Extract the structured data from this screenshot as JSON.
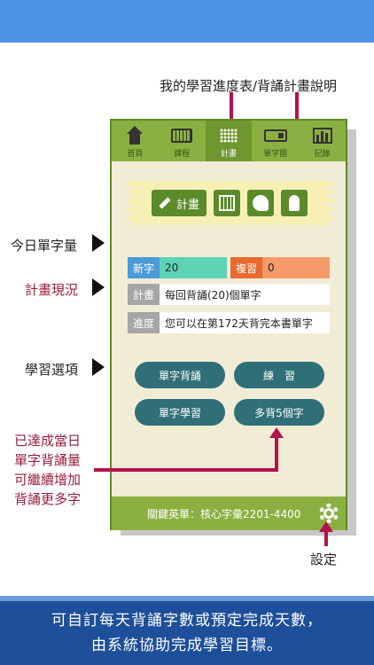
{
  "tabs": [
    {
      "label": "首頁",
      "icon": "home-icon"
    },
    {
      "label": "課程",
      "icon": "course-icon"
    },
    {
      "label": "計畫",
      "icon": "plan-dots-icon"
    },
    {
      "label": "單字團",
      "icon": "vocab-card-icon"
    },
    {
      "label": "記錄",
      "icon": "chart-icon"
    }
  ],
  "ribbon": {
    "plan_label": "計畫"
  },
  "stats": {
    "new_label": "新字",
    "new_value": "20",
    "review_label": "複習",
    "review_value": "0"
  },
  "plan": {
    "label": "計畫",
    "value": "每回背誦(20)個單字"
  },
  "progress": {
    "label": "進度",
    "value": "您可以在第172天背完本書單字"
  },
  "buttons": {
    "recite": "單字背誦",
    "practice": "練　習",
    "learn": "單字學習",
    "more": "多背5個字"
  },
  "footer": {
    "text": "關鍵英單：核心字彙2201-4400"
  },
  "annotations": {
    "top": "我的學習進度表/背誦計畫說明",
    "today": "今日單字量",
    "status": "計畫現況",
    "options": "學習選項",
    "done": [
      "已達成當日",
      "單字背誦量",
      "可繼續增加",
      "背誦更多字"
    ],
    "settings": "設定"
  },
  "caption": [
    "可自訂每天背誦字數或預定完成天數，",
    "由系統協助完成學習目標。"
  ],
  "colors": {
    "tab_bg": "#8bb041",
    "accent": "#5a8a2a",
    "new": "#5fd3b5",
    "review": "#f79a6a",
    "pill": "#2f6f78",
    "annotation": "#b3124d"
  }
}
